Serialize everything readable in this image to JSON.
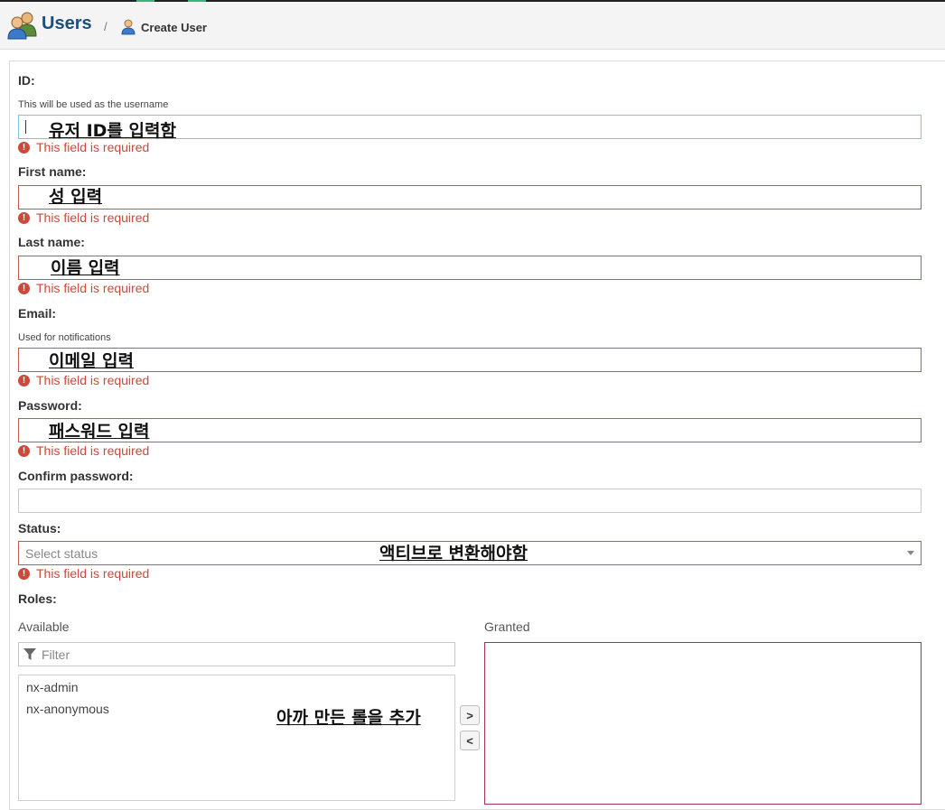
{
  "header": {
    "title": "Users",
    "separator": "/",
    "breadcrumb": "Create User"
  },
  "form": {
    "id": {
      "label": "ID:",
      "help": "This will be used as the username",
      "error": "This field is required"
    },
    "first_name": {
      "label": "First name:",
      "error": "This field is required"
    },
    "last_name": {
      "label": "Last name:",
      "error": "This field is required"
    },
    "email": {
      "label": "Email:",
      "help": "Used for notifications",
      "error": "This field is required"
    },
    "password": {
      "label": "Password:",
      "error": "This field is required"
    },
    "confirm_password": {
      "label": "Confirm password:"
    },
    "status": {
      "label": "Status:",
      "placeholder": "Select status",
      "error": "This field is required"
    },
    "roles": {
      "label": "Roles:",
      "available_label": "Available",
      "granted_label": "Granted",
      "filter_placeholder": "Filter",
      "available_items": [
        "nx-admin",
        "nx-anonymous"
      ],
      "add_button": ">",
      "remove_button": "<"
    }
  },
  "annotations": {
    "id": "유저 ID를 입력함",
    "first_name": "성 입력",
    "last_name": "이름 입력",
    "email": "이메일 입력",
    "password": "패스워드 입력",
    "status": "액티브로 변환해야함",
    "roles": "아까 만든 롤을 추가"
  },
  "colors": {
    "error": "#cc4a3c",
    "title": "#1b4f7a",
    "focus_border": "#7fc6d4",
    "granted_border": "#a8315c"
  }
}
